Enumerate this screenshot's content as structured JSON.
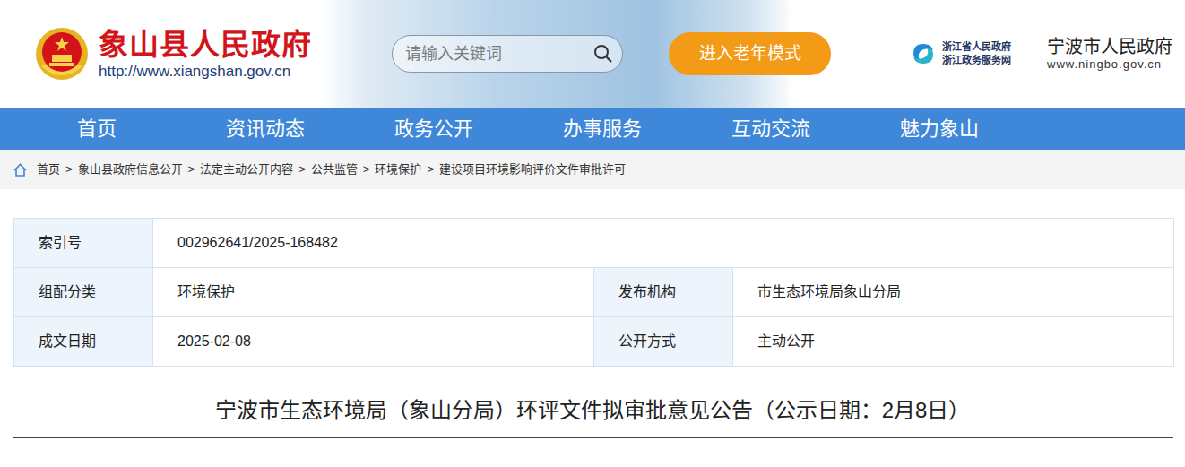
{
  "header": {
    "site_title": "象山县人民政府",
    "site_url": "http://www.xiangshan.gov.cn",
    "search": {
      "placeholder": "请输入关键词"
    },
    "elder_mode_button": "进入老年模式",
    "zj_logo": {
      "line1": "浙江省人民政府",
      "line2": "浙江政务服务网"
    },
    "ningbo": {
      "name": "宁波市人民政府",
      "url": "www.ningbo.gov.cn"
    }
  },
  "nav": [
    {
      "label": "首页"
    },
    {
      "label": "资讯动态"
    },
    {
      "label": "政务公开"
    },
    {
      "label": "办事服务"
    },
    {
      "label": "互动交流"
    },
    {
      "label": "魅力象山"
    }
  ],
  "breadcrumb": {
    "separator": ">",
    "items": [
      "首页",
      "象山县政府信息公开",
      "法定主动公开内容",
      "公共监管",
      "环境保护",
      "建设项目环境影响评价文件审批许可"
    ]
  },
  "info_table": {
    "rows": [
      [
        {
          "label": "索引号",
          "value": "002962641/2025-168482"
        }
      ],
      [
        {
          "label": "组配分类",
          "value": "环境保护"
        },
        {
          "label": "发布机构",
          "value": "市生态环境局象山分局"
        }
      ],
      [
        {
          "label": "成文日期",
          "value": "2025-02-08"
        },
        {
          "label": "公开方式",
          "value": "主动公开"
        }
      ]
    ]
  },
  "title": "宁波市生态环境局（象山分局）环评文件拟审批意见公告（公示日期：2月8日）"
}
